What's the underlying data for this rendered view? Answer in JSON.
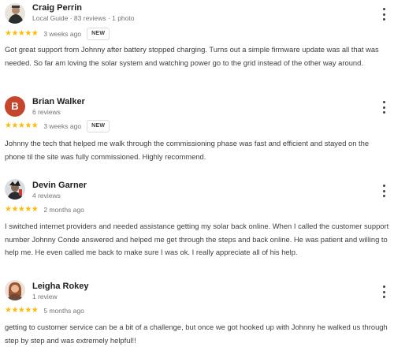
{
  "reviews": [
    {
      "name": "Craig Perrin",
      "meta": "Local Guide · 83 reviews · 1 photo",
      "stars": "★★★★★",
      "rating": 5,
      "date": "3 weeks ago",
      "badge": "NEW",
      "text": "Got great support from Johnny after battery stopped charging. Turns out a simple firmware update was all that was needed. So far am loving the solar system and watching power go to the grid instead of the other way around.",
      "avatar_icon": "profile-photo"
    },
    {
      "name": "Brian Walker",
      "meta": "6 reviews",
      "stars": "★★★★★",
      "rating": 5,
      "date": "3 weeks ago",
      "badge": "NEW",
      "text": "Johnny the tech that helped me walk through the commissioning phase was fast and efficient and stayed on the phone til the site was fully commissioned. Highly recommend.",
      "avatar_letter": "B",
      "avatar_color": "#c5462c"
    },
    {
      "name": "Devin Garner",
      "meta": "4 reviews",
      "stars": "★★★★★",
      "rating": 5,
      "date": "2 months ago",
      "text": "I switched internet providers and needed assistance getting my solar back online. When I called the customer support number Johnny Conde answered and helped me get through the steps and back online. He was patient and willing to help me. He even called me back to make sure I was ok. I really appreciate all of his help.",
      "avatar_icon": "profile-photo"
    },
    {
      "name": "Leigha Rokey",
      "meta": "1 review",
      "stars": "★★★★★",
      "rating": 5,
      "date": "5 months ago",
      "text": "getting to customer service can be a bit of a challenge, but once we got hooked up with Johnny he walked us through step by step and was extremely helpful!!",
      "avatar_icon": "profile-photo"
    }
  ],
  "colors": {
    "star": "#fbbc04",
    "meta_text": "#70757a",
    "body_text": "#3c4043"
  }
}
